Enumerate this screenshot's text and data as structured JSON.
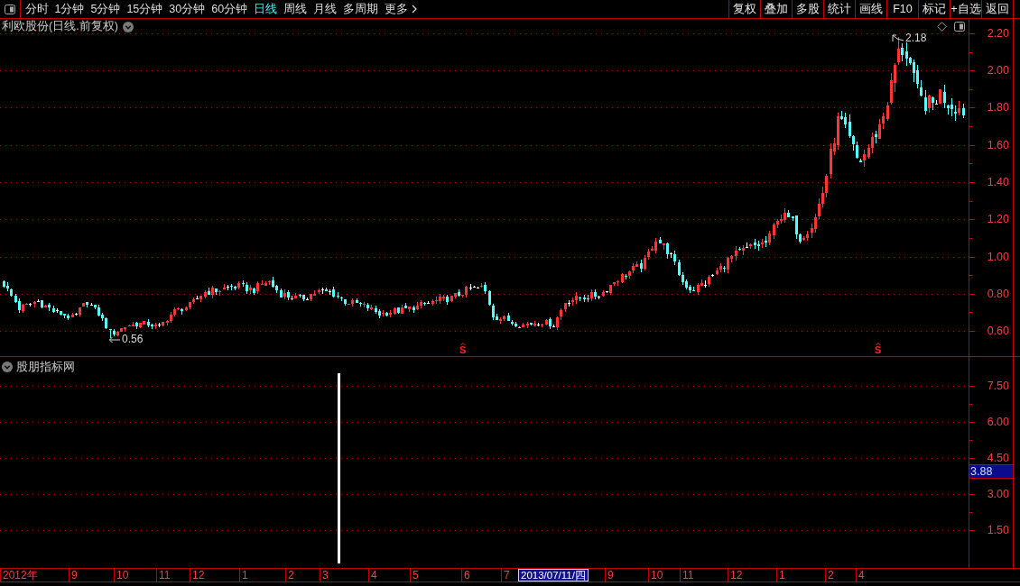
{
  "toolbar": {
    "periods": [
      {
        "label": "分时",
        "selected": false
      },
      {
        "label": "1分钟",
        "selected": false
      },
      {
        "label": "5分钟",
        "selected": false
      },
      {
        "label": "15分钟",
        "selected": false
      },
      {
        "label": "30分钟",
        "selected": false
      },
      {
        "label": "60分钟",
        "selected": false
      },
      {
        "label": "日线",
        "selected": true
      },
      {
        "label": "周线",
        "selected": false
      },
      {
        "label": "月线",
        "selected": false
      },
      {
        "label": "多周期",
        "selected": false
      }
    ],
    "more": "更多",
    "actions": [
      "复权",
      "叠加",
      "多股",
      "统计",
      "画线",
      "F10",
      "标记",
      "+自选",
      "返回"
    ]
  },
  "price_panel": {
    "title": "利欧股份(日线.前复权)",
    "high_label": "2.18",
    "low_label": "0.56",
    "signals": [
      "S",
      "S"
    ],
    "axis_labels": [
      "2.20",
      "2.00",
      "1.80",
      "1.60",
      "1.40",
      "1.20",
      "1.00",
      "0.80",
      "0.60"
    ]
  },
  "indicator_panel": {
    "title": "股朋指标网",
    "axis_labels": [
      "7.50",
      "6.00",
      "4.50",
      "3.00",
      "1.50"
    ],
    "current_value": "3.88"
  },
  "date_axis": [
    {
      "label": "2012年",
      "kind": "tick"
    },
    {
      "label": "9",
      "kind": "tick"
    },
    {
      "label": "10",
      "kind": "tick"
    },
    {
      "label": "11",
      "kind": "tick"
    },
    {
      "label": "12",
      "kind": "tick"
    },
    {
      "label": "1",
      "kind": "tick"
    },
    {
      "label": "2",
      "kind": "tick"
    },
    {
      "label": "3",
      "kind": "tick"
    },
    {
      "label": "4",
      "kind": "tick"
    },
    {
      "label": "5",
      "kind": "tick"
    },
    {
      "label": "6",
      "kind": "tick"
    },
    {
      "label": "7",
      "kind": "tick"
    },
    {
      "label": "2013/07/11/四",
      "kind": "cursor"
    },
    {
      "label": "9",
      "kind": "tick"
    },
    {
      "label": "10",
      "kind": "tick"
    },
    {
      "label": "11",
      "kind": "tick"
    },
    {
      "label": "12",
      "kind": "tick"
    },
    {
      "label": "1",
      "kind": "tick"
    },
    {
      "label": "2",
      "kind": "tick"
    },
    {
      "label": "4",
      "kind": "tick"
    }
  ]
}
